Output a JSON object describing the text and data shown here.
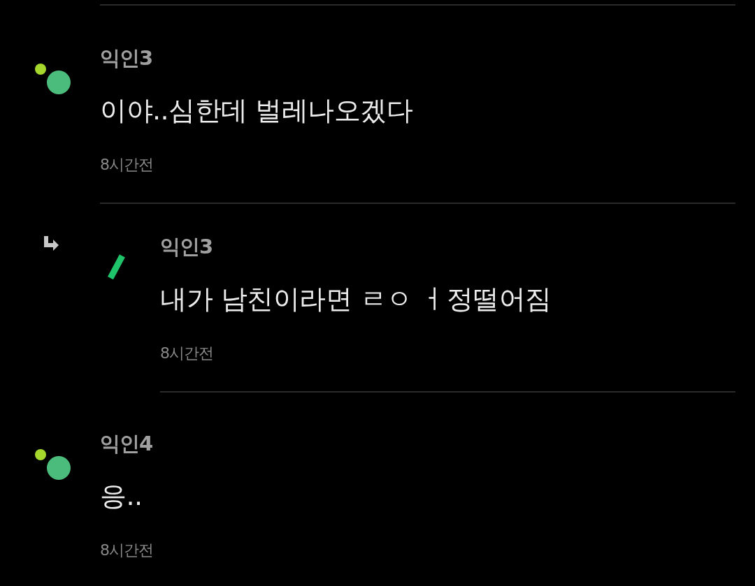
{
  "comments": [
    {
      "kind": "comment",
      "avatar": {
        "kind": "dots"
      },
      "author": "익인3",
      "text": "이야..심한데 벌레나오겠다",
      "time": "8시간전"
    },
    {
      "kind": "reply",
      "avatar": {
        "kind": "bar"
      },
      "author": "익인3",
      "text": "내가 남친이라면 ㄹㅇ ㅓ정떨어짐",
      "time": "8시간전"
    },
    {
      "kind": "comment",
      "avatar": {
        "kind": "dots"
      },
      "author": "익인4",
      "text": "응..",
      "time": "8시간전"
    }
  ]
}
